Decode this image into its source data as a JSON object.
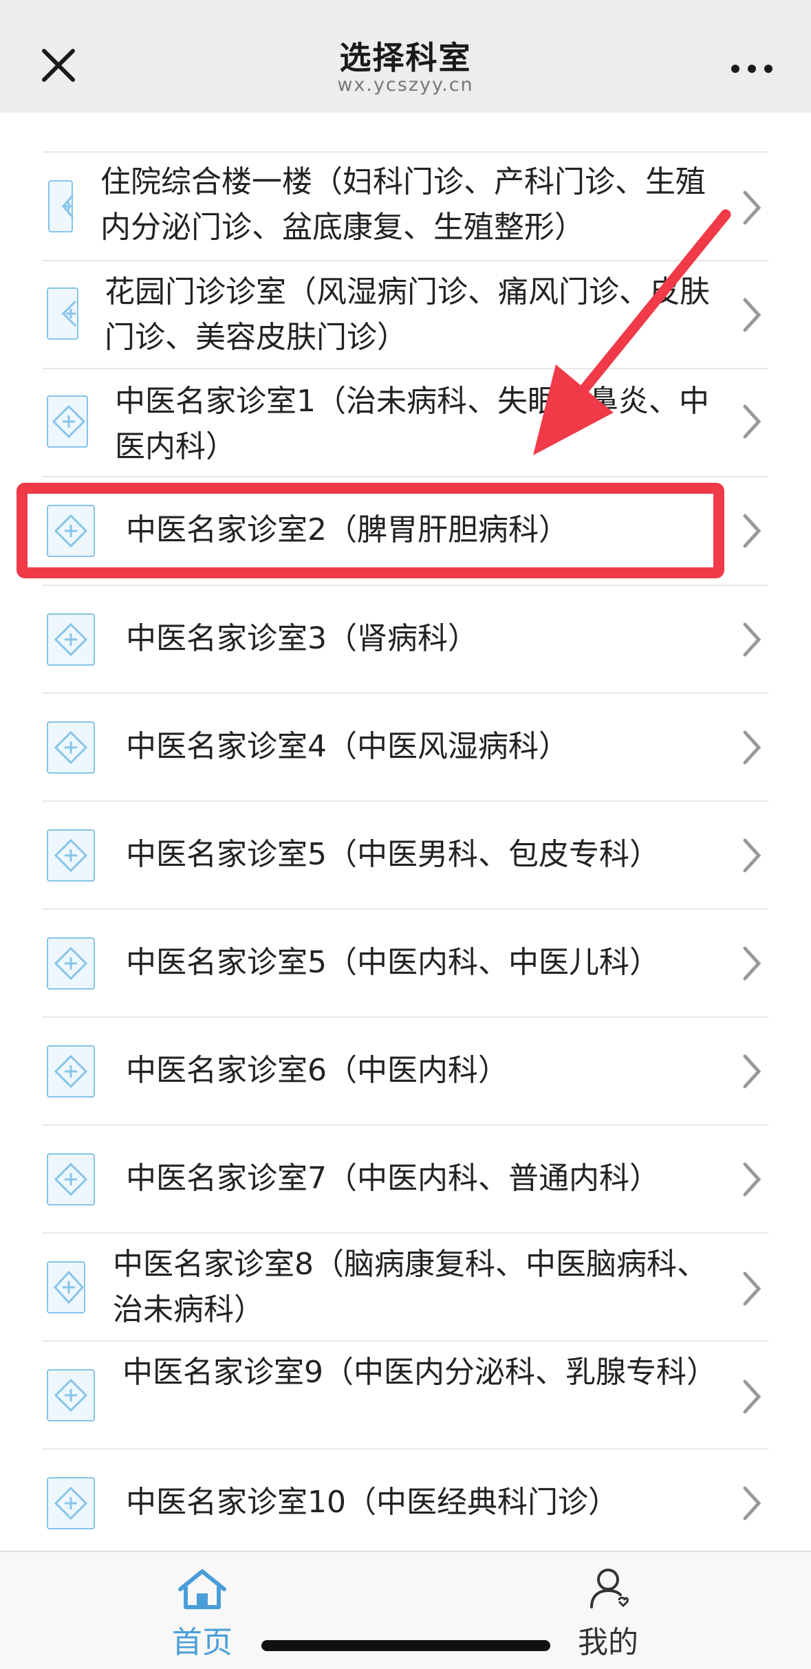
{
  "header": {
    "title": "选择科室",
    "subtitle": "wx.ycszyy.cn",
    "close_icon": "close-icon",
    "more_icon": "more-horizontal-icon"
  },
  "departments": [
    {
      "label": ""
    },
    {
      "label": "住院综合楼一楼（妇科门诊、产科门诊、生殖内分泌门诊、盆底康复、生殖整形）"
    },
    {
      "label": "花园门诊诊室（风湿病门诊、痛风门诊、皮肤门诊、美容皮肤门诊）"
    },
    {
      "label": "中医名家诊室1（治未病科、失眠、鼻炎、中医内科）"
    },
    {
      "label": "中医名家诊室2（脾胃肝胆病科）"
    },
    {
      "label": "中医名家诊室3（肾病科）"
    },
    {
      "label": "中医名家诊室4（中医风湿病科）"
    },
    {
      "label": "中医名家诊室5（中医男科、包皮专科）"
    },
    {
      "label": "中医名家诊室5（中医内科、中医儿科）"
    },
    {
      "label": "中医名家诊室6（中医内科）"
    },
    {
      "label": "中医名家诊室7（中医内科、普通内科）"
    },
    {
      "label": "中医名家诊室8（脑病康复科、中医脑病科、治未病科）"
    },
    {
      "label": "中医名家诊室9（中医内分泌科、乳腺专科）"
    },
    {
      "label": "中医名家诊室10（中医经典科门诊）"
    }
  ],
  "row_icon": "department-plus-icon",
  "tabbar": {
    "home_label": "首页",
    "mine_label": "我的",
    "active_color": "#4a9ed8",
    "inactive_color": "#333333"
  },
  "annotation": {
    "highlight_color": "#f03a48",
    "highlighted_item": "中医名家诊室2（脾胃肝胆病科）"
  }
}
